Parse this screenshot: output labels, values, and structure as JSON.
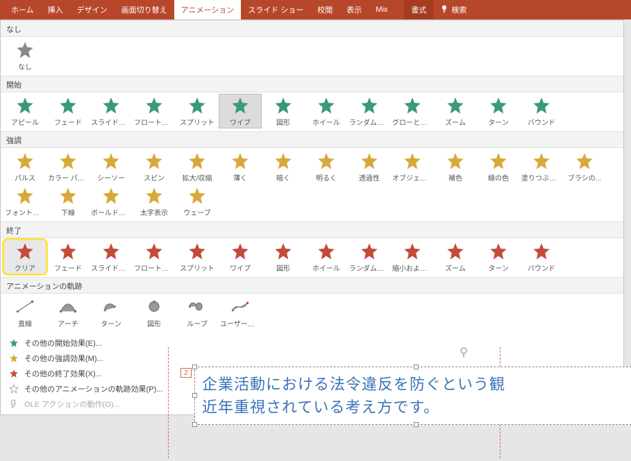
{
  "ribbon": {
    "tabs": [
      "ホーム",
      "挿入",
      "デザイン",
      "画面切り替え",
      "アニメーション",
      "スライド ショー",
      "校閲",
      "表示",
      "Mix"
    ],
    "active_index": 4,
    "format_tab": "書式",
    "search_placeholder": "検索"
  },
  "sections": {
    "none": {
      "title": "なし",
      "items": [
        "なし"
      ]
    },
    "entrance": {
      "title": "開始",
      "items": [
        "アピール",
        "フェード",
        "スライドイン",
        "フロートイン",
        "スプリット",
        "ワイプ",
        "図形",
        "ホイール",
        "ランダムスト...",
        "グローとターン",
        "ズーム",
        "ターン",
        "バウンド"
      ],
      "selected": "ワイプ"
    },
    "emphasis": {
      "title": "強調",
      "items": [
        "パルス",
        "カラー パルス",
        "シーソー",
        "スピン",
        "拡大/収縮",
        "薄く",
        "暗く",
        "明るく",
        "透過性",
        "オブジェクト ...",
        "補色",
        "線の色",
        "塗りつぶしの色",
        "ブラシの...",
        "フォントの色",
        "下線",
        "ボールドフラ...",
        "太字表示",
        "ウェーブ"
      ]
    },
    "exit": {
      "title": "終了",
      "items": [
        "クリア",
        "フェード",
        "スライドアウト",
        "フロートアウト",
        "スプリット",
        "ワイプ",
        "図形",
        "ホイール",
        "ランダムスト...",
        "縮小および...",
        "ズーム",
        "ターン",
        "バウンド"
      ],
      "highlighted": "クリア"
    },
    "motion": {
      "title": "アニメーションの軌跡",
      "items": [
        "直線",
        "アーチ",
        "ターン",
        "図形",
        "ループ",
        "ユーザー設..."
      ]
    }
  },
  "extra": {
    "entrance": "その他の開始効果(E)...",
    "emphasis": "その他の強調効果(M)...",
    "exit": "その他の終了効果(X)...",
    "motion": "その他のアニメーションの軌跡効果(P)...",
    "ole": "OLE アクションの動作(O)..."
  },
  "slide": {
    "anim_number": "2",
    "line1": "企業活動における法令違反を防ぐという観",
    "line2": "近年重視されている考え方です。"
  }
}
